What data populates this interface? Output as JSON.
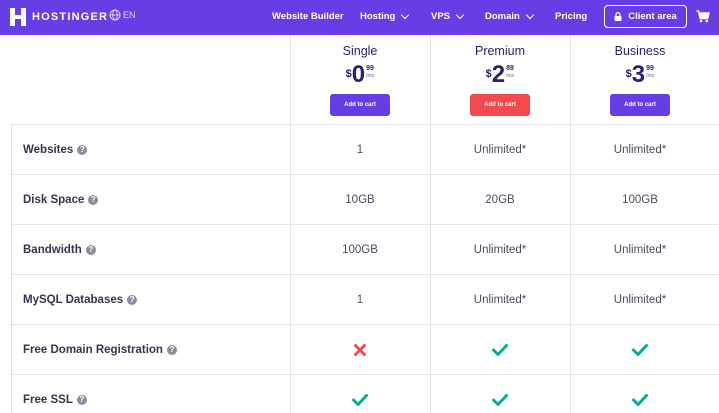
{
  "nav": {
    "brand": "HOSTINGER",
    "lang": "EN",
    "items": [
      {
        "label": "Website Builder",
        "dropdown": false
      },
      {
        "label": "Hosting",
        "dropdown": true
      },
      {
        "label": "VPS",
        "dropdown": true
      },
      {
        "label": "Domain",
        "dropdown": true
      },
      {
        "label": "Pricing",
        "dropdown": false
      }
    ],
    "client_area": "Client area",
    "icons": [
      "hostinger-logo-icon",
      "globe-icon",
      "lock-icon",
      "cart-icon"
    ]
  },
  "plans": [
    {
      "name": "Single",
      "currency": "$",
      "price_main": "0",
      "price_cents": "99",
      "per": "/mo",
      "cta": "Add to cart",
      "cta_color": "#673de6"
    },
    {
      "name": "Premium",
      "currency": "$",
      "price_main": "2",
      "price_cents": "89",
      "per": "/mo",
      "cta": "Add to cart",
      "cta_color": "#fc5185"
    },
    {
      "name": "Business",
      "currency": "$",
      "price_main": "3",
      "price_cents": "99",
      "per": "/mo",
      "cta": "Add to cart",
      "cta_color": "#673de6"
    }
  ],
  "features": [
    {
      "label": "Websites",
      "values": [
        "1",
        "Unlimited*",
        "Unlimited*"
      ]
    },
    {
      "label": "Disk Space",
      "values": [
        "10GB",
        "20GB",
        "100GB"
      ]
    },
    {
      "label": "Bandwidth",
      "values": [
        "100GB",
        "Unlimited*",
        "Unlimited*"
      ]
    },
    {
      "label": "MySQL Databases",
      "values": [
        "1",
        "Unlimited*",
        "Unlimited*"
      ]
    },
    {
      "label": "Free Domain Registration",
      "values": [
        "cross",
        "check",
        "check"
      ]
    },
    {
      "label": "Free SSL",
      "values": [
        "check",
        "check",
        "check"
      ]
    }
  ],
  "colors": {
    "brand": "#673de6",
    "check": "#00b090",
    "cross": "#fc5185",
    "premium_button": "#fc5185"
  },
  "help_glyph": "?"
}
